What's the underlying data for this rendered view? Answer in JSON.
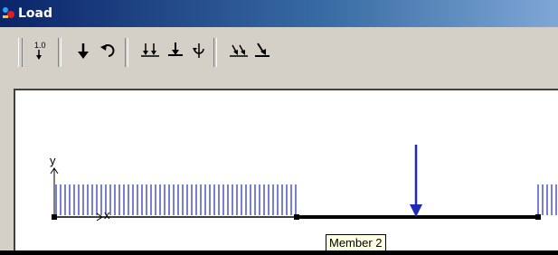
{
  "window": {
    "title": "Load"
  },
  "toolbar": {
    "buttons": [
      {
        "icon": "load-value-icon",
        "label": "1.0"
      },
      {
        "icon": "point-load-arrow-icon"
      },
      {
        "icon": "moment-icon"
      },
      {
        "icon": "distributed-load-icon"
      },
      {
        "icon": "point-load-on-member-icon"
      },
      {
        "icon": "concentrated-moment-on-member-icon"
      },
      {
        "icon": "uniform-load-icon"
      },
      {
        "icon": "inclined-load-icon"
      }
    ]
  },
  "canvas": {
    "axes": {
      "x_label": "x",
      "y_label": "y"
    },
    "colors": {
      "load": "#1f2bb8",
      "member": "#000000",
      "axes": "#000000"
    }
  },
  "tooltip": {
    "text": "Member 2"
  }
}
